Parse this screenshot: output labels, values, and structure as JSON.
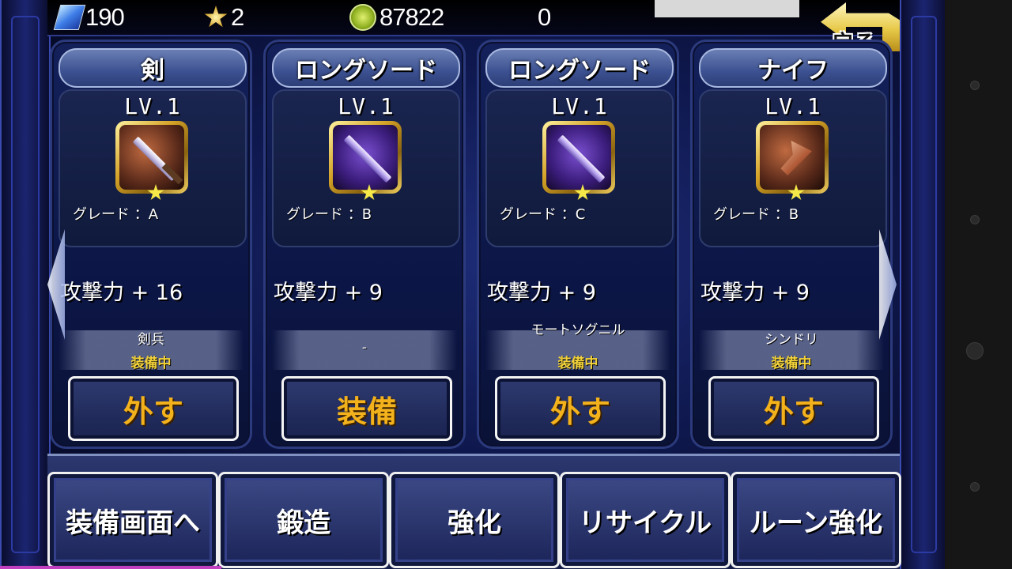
{
  "topbar": {
    "gems": "190",
    "medals": "2",
    "coins": "87822",
    "extra": "0",
    "back_label": "戻る"
  },
  "cards": [
    {
      "title": "剣",
      "level": "LV.1",
      "grade": "グレード ：A",
      "attack": "攻撃力 + 16",
      "owner": "剣兵",
      "status": "装備中",
      "button": "外す",
      "icon": "broadsword-icon"
    },
    {
      "title": "ロングソード",
      "level": "LV.1",
      "grade": "グレード ：B",
      "attack": "攻撃力 + 9",
      "owner": "-",
      "status": "",
      "button": "装備",
      "icon": "longsword-icon"
    },
    {
      "title": "ロングソード",
      "level": "LV.1",
      "grade": "グレード ：C",
      "attack": "攻撃力 + 9",
      "owner": "モートソグニル",
      "status": "装備中",
      "button": "外す",
      "icon": "longsword-icon"
    },
    {
      "title": "ナイフ",
      "level": "LV.1",
      "grade": "グレード ：B",
      "attack": "攻撃力 + 9",
      "owner": "シンドリ",
      "status": "装備中",
      "button": "外す",
      "icon": "knife-icon"
    }
  ],
  "menu": [
    "装備画面へ",
    "鍛造",
    "強化",
    "リサイクル",
    "ルーン強化"
  ],
  "colors": {
    "button_text": "#f3b21c",
    "equipped_text": "#f2d23a",
    "background": "#101a52"
  }
}
